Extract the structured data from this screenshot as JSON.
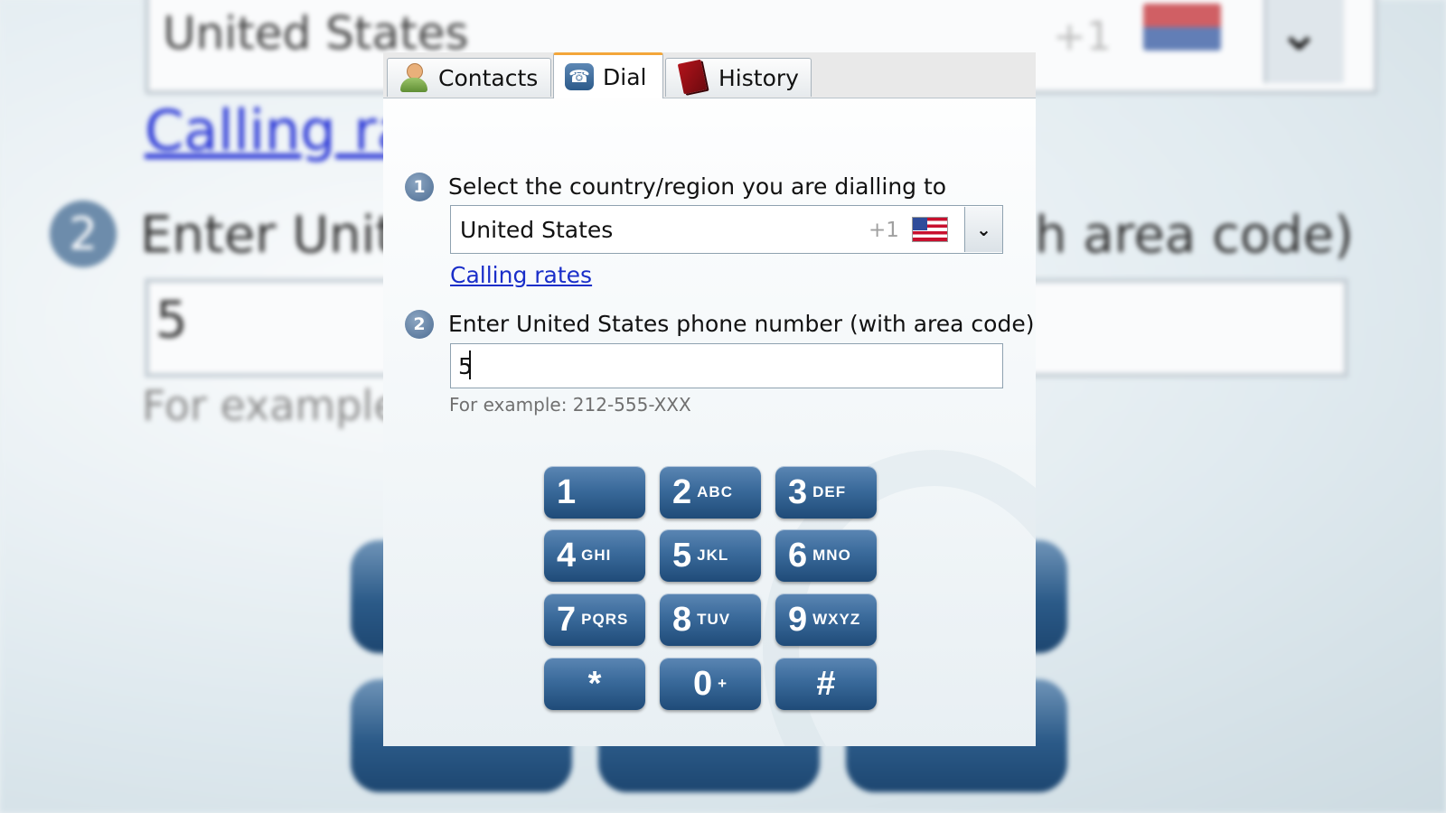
{
  "tabs": [
    {
      "label": "Contacts",
      "icon": "contacts-icon"
    },
    {
      "label": "Dial",
      "icon": "phone-icon",
      "active": true
    },
    {
      "label": "History",
      "icon": "book-icon"
    }
  ],
  "step1": {
    "number": "1",
    "label": "Select the country/region you are dialling to"
  },
  "country_select": {
    "value": "United States",
    "code": "+1",
    "flag": "us-flag-icon"
  },
  "calling_rates_link": "Calling rates",
  "step2": {
    "number": "2",
    "label": "Enter United States phone number (with area code)"
  },
  "phone_input": {
    "value": "5"
  },
  "example_text": "For example: 212-555-XXX",
  "keypad": [
    {
      "digit": "1",
      "letters": ""
    },
    {
      "digit": "2",
      "letters": "ABC"
    },
    {
      "digit": "3",
      "letters": "DEF"
    },
    {
      "digit": "4",
      "letters": "GHI"
    },
    {
      "digit": "5",
      "letters": "JKL"
    },
    {
      "digit": "6",
      "letters": "MNO"
    },
    {
      "digit": "7",
      "letters": "PQRS"
    },
    {
      "digit": "8",
      "letters": "TUV"
    },
    {
      "digit": "9",
      "letters": "WXYZ"
    },
    {
      "digit": "*",
      "letters": ""
    },
    {
      "digit": "0",
      "letters": "+"
    },
    {
      "digit": "#",
      "letters": ""
    }
  ],
  "colors": {
    "accent_tab": "#f3a63a",
    "link": "#1a2ec9",
    "key_blue": "#3a6a9b"
  }
}
